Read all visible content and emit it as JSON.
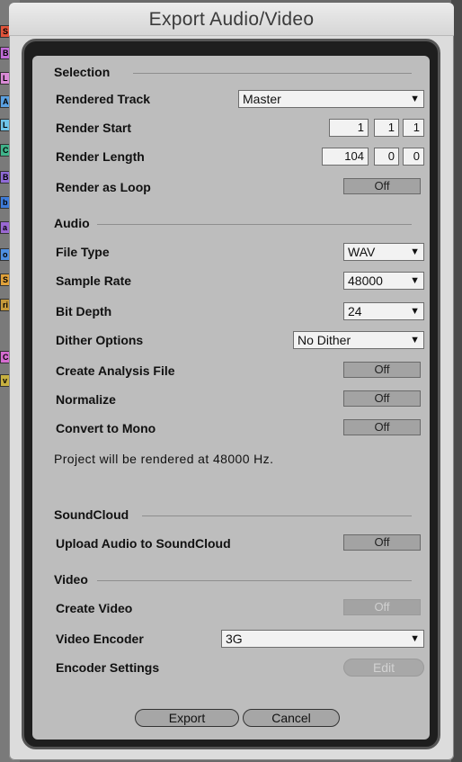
{
  "window": {
    "title": "Export Audio/Video"
  },
  "background_strip": [
    "S",
    "B",
    "L",
    "AI",
    "L",
    "C",
    "B",
    "b",
    "a",
    "o",
    "S",
    "ri",
    "C",
    "v"
  ],
  "selection": {
    "header": "Selection",
    "rendered_track": {
      "label": "Rendered Track",
      "value": "Master"
    },
    "render_start": {
      "label": "Render Start",
      "values": [
        "1",
        "1",
        "1"
      ]
    },
    "render_length": {
      "label": "Render Length",
      "values": [
        "104",
        "0",
        "0"
      ]
    },
    "render_as_loop": {
      "label": "Render as Loop",
      "value": "Off"
    }
  },
  "audio": {
    "header": "Audio",
    "file_type": {
      "label": "File Type",
      "value": "WAV"
    },
    "sample_rate": {
      "label": "Sample Rate",
      "value": "48000"
    },
    "bit_depth": {
      "label": "Bit Depth",
      "value": "24"
    },
    "dither_options": {
      "label": "Dither Options",
      "value": "No Dither"
    },
    "create_analysis_file": {
      "label": "Create Analysis File",
      "value": "Off"
    },
    "normalize": {
      "label": "Normalize",
      "value": "Off"
    },
    "convert_to_mono": {
      "label": "Convert to Mono",
      "value": "Off"
    },
    "note": "Project will be rendered at 48000 Hz."
  },
  "soundcloud": {
    "header": "SoundCloud",
    "upload": {
      "label": "Upload Audio to SoundCloud",
      "value": "Off"
    }
  },
  "video": {
    "header": "Video",
    "create_video": {
      "label": "Create Video",
      "value": "Off"
    },
    "video_encoder": {
      "label": "Video Encoder",
      "value": "3G"
    },
    "encoder_settings": {
      "label": "Encoder Settings",
      "button": "Edit"
    }
  },
  "buttons": {
    "export": "Export",
    "cancel": "Cancel"
  },
  "icons": {
    "dropdown_arrow": "▼"
  },
  "colors": {
    "panel": "#bdbdbd",
    "frame": "#1e1e1e",
    "toggle": "#a3a3a3"
  }
}
